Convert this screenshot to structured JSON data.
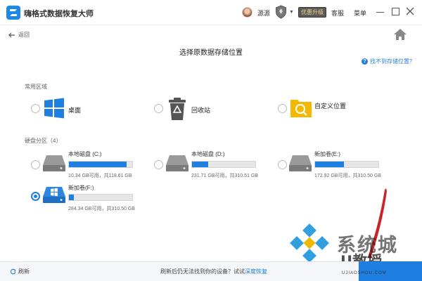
{
  "app": {
    "title": "嗨格式数据恢复大师"
  },
  "header": {
    "username": "源源",
    "upgrade_label": "优惠升级",
    "support_label": "客服",
    "menu_label": "菜单"
  },
  "nav": {
    "back_label": "返回"
  },
  "page": {
    "title": "选择原数据存储位置",
    "help_link": "找不到存储位置？"
  },
  "common_areas": {
    "label": "常用区域",
    "items": [
      {
        "label": "桌面",
        "icon": "windows-icon"
      },
      {
        "label": "回收站",
        "icon": "recycle-bin-icon"
      },
      {
        "label": "自定义位置",
        "icon": "folder-search-icon"
      }
    ]
  },
  "partitions": {
    "label": "硬盘分区（4）",
    "items": [
      {
        "name": "本地磁盘 (C:)",
        "capacity": "10.34 GB可用，共118.61 GB",
        "used_fraction": 0.91,
        "selected": false
      },
      {
        "name": "本地磁盘 (D:)",
        "capacity": "231.71 GB可用，共310.51 GB",
        "used_fraction": 0.25,
        "selected": false
      },
      {
        "name": "新加卷(E:)",
        "capacity": "172.92 GB可用，共310.50 GB",
        "used_fraction": 0.45,
        "selected": false
      },
      {
        "name": "新加卷(F:)",
        "capacity": "284.34 GB可用，共310.50 GB",
        "used_fraction": 0.08,
        "selected": true
      }
    ]
  },
  "footer": {
    "refresh_label": "刷新",
    "message": "刷新后仍无法找到你的设备？试试",
    "deep_recovery_link": "深度恢复"
  },
  "watermark": {
    "line1": "系统城",
    "line2": "U教授",
    "line3": "UJIAOSHOU.COM"
  },
  "colors": {
    "accent": "#1e7fe0",
    "upgrade_bg": "#5a5a5a",
    "folder": "#f5b800"
  }
}
